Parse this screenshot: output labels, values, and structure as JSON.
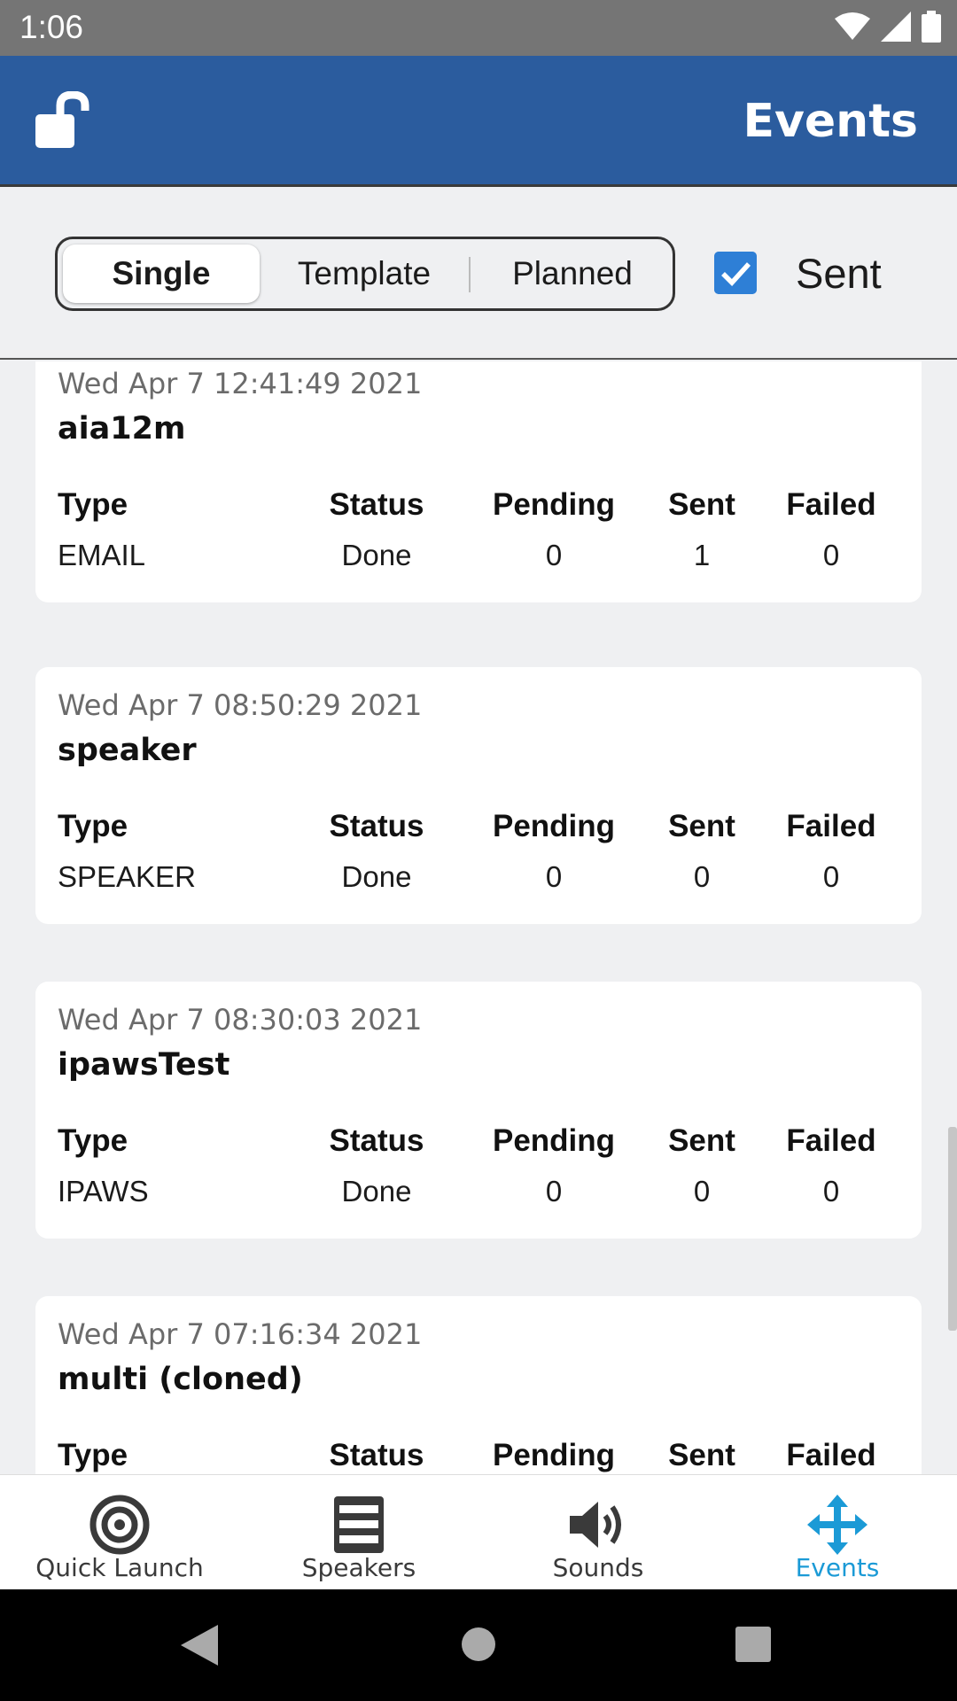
{
  "status_bar": {
    "time": "1:06"
  },
  "app_bar": {
    "title": "Events",
    "lock_icon": "unlock-icon"
  },
  "filters": {
    "segments": [
      {
        "label": "Single",
        "active": true
      },
      {
        "label": "Template",
        "active": false
      },
      {
        "label": "Planned",
        "active": false
      }
    ],
    "sent_checkbox": {
      "label": "Sent",
      "checked": true
    }
  },
  "columns": {
    "type": "Type",
    "status": "Status",
    "pending": "Pending",
    "sent": "Sent",
    "failed": "Failed"
  },
  "events": [
    {
      "date": "Wed Apr  7 12:41:49 2021",
      "name": "aia12m",
      "type": "EMAIL",
      "status": "Done",
      "pending": "0",
      "sent": "1",
      "failed": "0"
    },
    {
      "date": "Wed Apr  7 08:50:29 2021",
      "name": "speaker",
      "type": "SPEAKER",
      "status": "Done",
      "pending": "0",
      "sent": "0",
      "failed": "0"
    },
    {
      "date": "Wed Apr  7 08:30:03 2021",
      "name": "ipawsTest",
      "type": "IPAWS",
      "status": "Done",
      "pending": "0",
      "sent": "0",
      "failed": "0"
    },
    {
      "date": "Wed Apr  7 07:16:34 2021",
      "name": "multi (cloned)",
      "type": "",
      "status": "",
      "pending": "",
      "sent": "",
      "failed": ""
    }
  ],
  "bottom_nav": [
    {
      "label": "Quick Launch",
      "icon": "target-icon",
      "active": false
    },
    {
      "label": "Speakers",
      "icon": "speaker-icon",
      "active": false
    },
    {
      "label": "Sounds",
      "icon": "volume-icon",
      "active": false
    },
    {
      "label": "Events",
      "icon": "move-arrows-icon",
      "active": true
    }
  ],
  "colors": {
    "app_bar": "#2b5c9e",
    "accent": "#1b9ad6",
    "checkbox": "#2e7fd6"
  }
}
